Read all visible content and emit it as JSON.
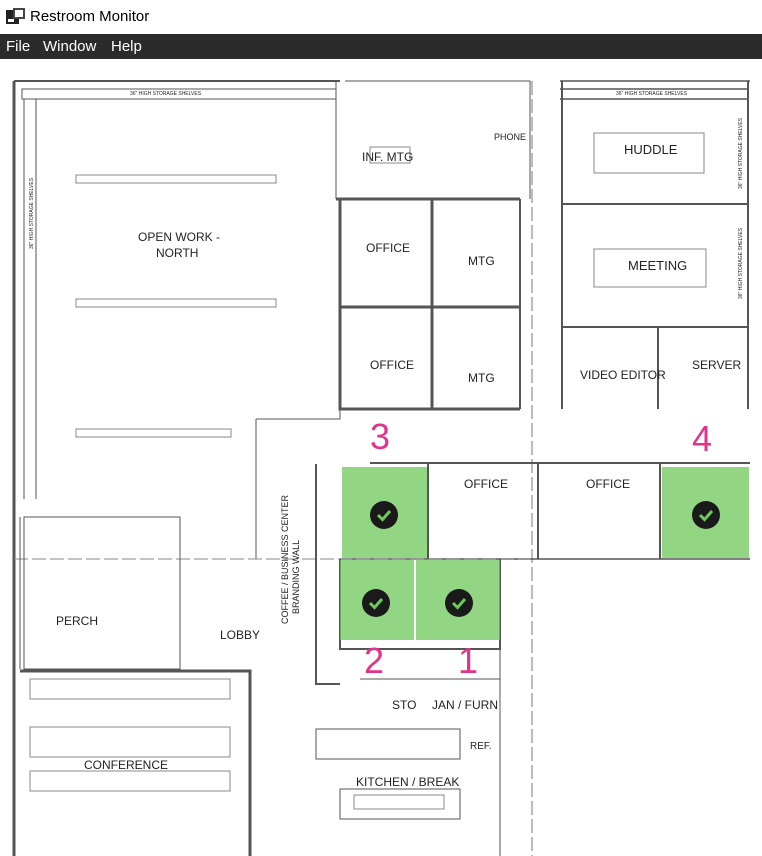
{
  "window": {
    "title": "Restroom Monitor",
    "icon": "app-window-icon"
  },
  "menu": {
    "file": "File",
    "window": "Window",
    "help": "Help"
  },
  "colors": {
    "occupied_free": "#6ec85a",
    "room_number": "#e0338a",
    "menubar": "#2b2b2b"
  },
  "floorplan": {
    "labels": {
      "open_work_1": "OPEN WORK -",
      "open_work_2": "NORTH",
      "inf_mtg": "INF. MTG",
      "phone": "PHONE",
      "office_a": "OFFICE",
      "office_b": "OFFICE",
      "mtg_a": "MTG",
      "mtg_b": "MTG",
      "huddle": "HUDDLE",
      "meeting": "MEETING",
      "video_editor": "VIDEO EDITOR",
      "server": "SERVER",
      "office_c": "OFFICE",
      "office_d": "OFFICE",
      "perch": "PERCH",
      "lobby": "LOBBY",
      "coffee_1": "COFFEE / BUSINESS CENTER",
      "coffee_2": "BRANDING WALL",
      "sto": "STO",
      "jan_furn": "JAN / FURN",
      "ref": "REF.",
      "conference": "CONFERENCE",
      "kitchen": "KITCHEN / BREAK",
      "shelves_left": "36\" HIGH STORAGE SHELVES",
      "shelves_right": "36\" HIGH STORAGE SHELVES",
      "shelves_vertical_left": "36\" HIGH STORAGE SHELVES",
      "shelves_vertical_right_1": "36\" HIGH STORAGE SHELVES",
      "shelves_vertical_right_2": "36\" HIGH STORAGE SHELVES"
    },
    "restrooms": [
      {
        "number": "1",
        "status": "available",
        "icon": "check-circle-icon"
      },
      {
        "number": "2",
        "status": "available",
        "icon": "check-circle-icon"
      },
      {
        "number": "3",
        "status": "available",
        "icon": "check-circle-icon"
      },
      {
        "number": "4",
        "status": "available",
        "icon": "check-circle-icon"
      }
    ]
  }
}
